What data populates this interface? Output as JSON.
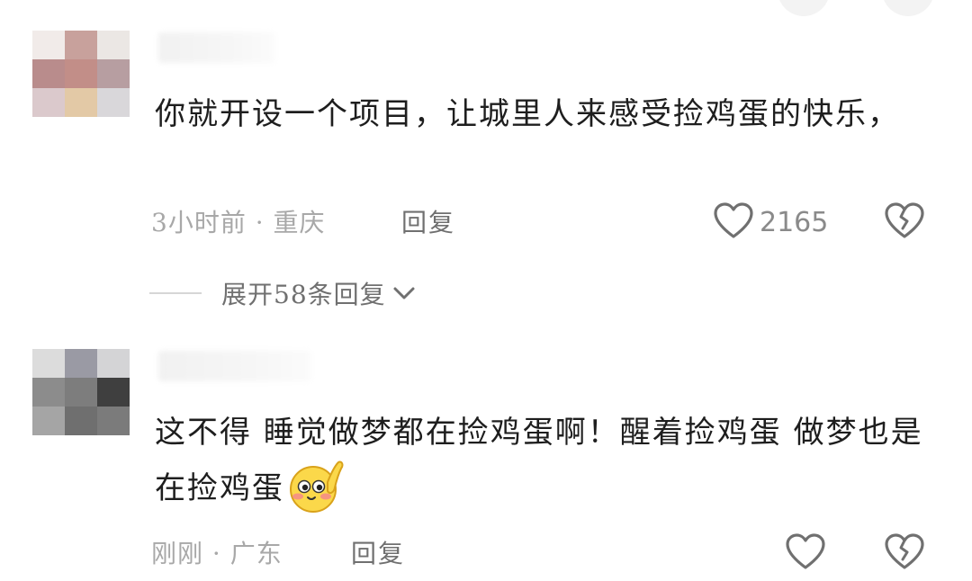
{
  "comments": [
    {
      "text": "你就开设一个项目，让城里人来感受捡鸡蛋的快乐，",
      "time_location": "3小时前 · 重庆",
      "reply_label": "回复",
      "like_count": "2165",
      "expand_label": "展开58条回复"
    },
    {
      "text": "这不得 睡觉做梦都在捡鸡蛋啊！醒着捡鸡蛋 做梦也是在捡鸡蛋",
      "time_location": "刚刚 · 广东",
      "reply_label": "回复",
      "emoji": "blushing-face-emoji"
    }
  ],
  "icons": {
    "like": "heart-outline-icon",
    "dislike": "broken-heart-icon",
    "expand": "chevron-down-icon"
  },
  "colors": {
    "text": "#1e1e1e",
    "meta": "#a8a8a8",
    "action": "#707070",
    "icon": "#707070"
  }
}
